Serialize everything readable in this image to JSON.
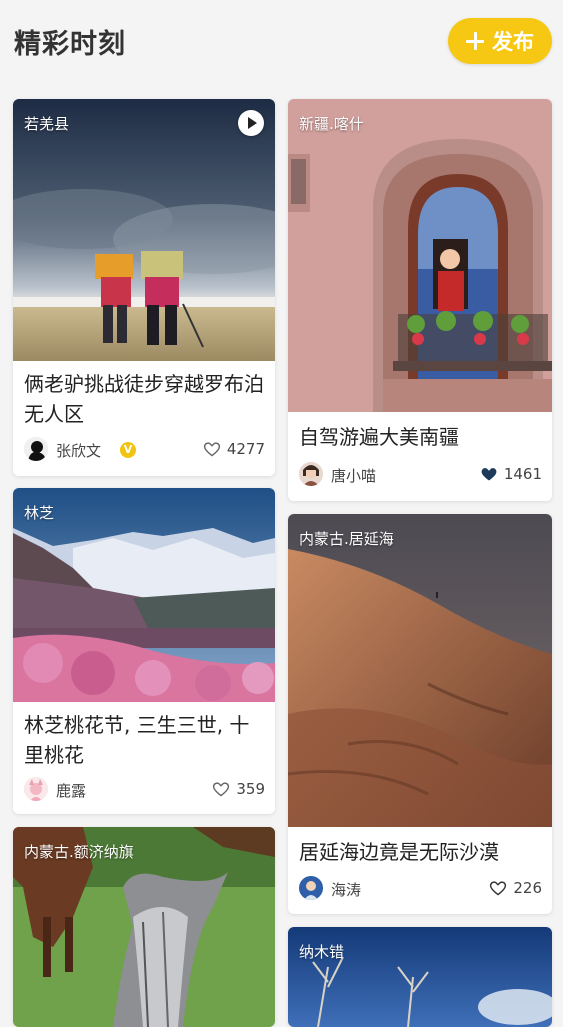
{
  "header": {
    "title": "精彩时刻",
    "publish_label": "发布"
  },
  "cards": [
    {
      "location": "若羌县",
      "title": "俩老驴挑战徒步穿越罗布泊无人区",
      "author": "张欣文",
      "verified_badge": "V",
      "likes": "4277",
      "liked": false,
      "has_video": true
    },
    {
      "location": "新疆.喀什",
      "title": "自驾游遍大美南疆",
      "author": "唐小喵",
      "likes": "1461",
      "liked": true
    },
    {
      "location": "林芝",
      "title": "林芝桃花节, 三生三世, 十里桃花",
      "author": "鹿露",
      "likes": "359",
      "liked": false
    },
    {
      "location": "内蒙古.居延海",
      "title": "居延海边竟是无际沙漠",
      "author": "海涛",
      "likes": "226",
      "liked": false
    },
    {
      "location": "内蒙古.额济纳旗"
    },
    {
      "location": "纳木错"
    }
  ],
  "colors": {
    "accent": "#f6c813",
    "liked_heart": "#1d3a5a",
    "background": "#f4f4f4"
  }
}
